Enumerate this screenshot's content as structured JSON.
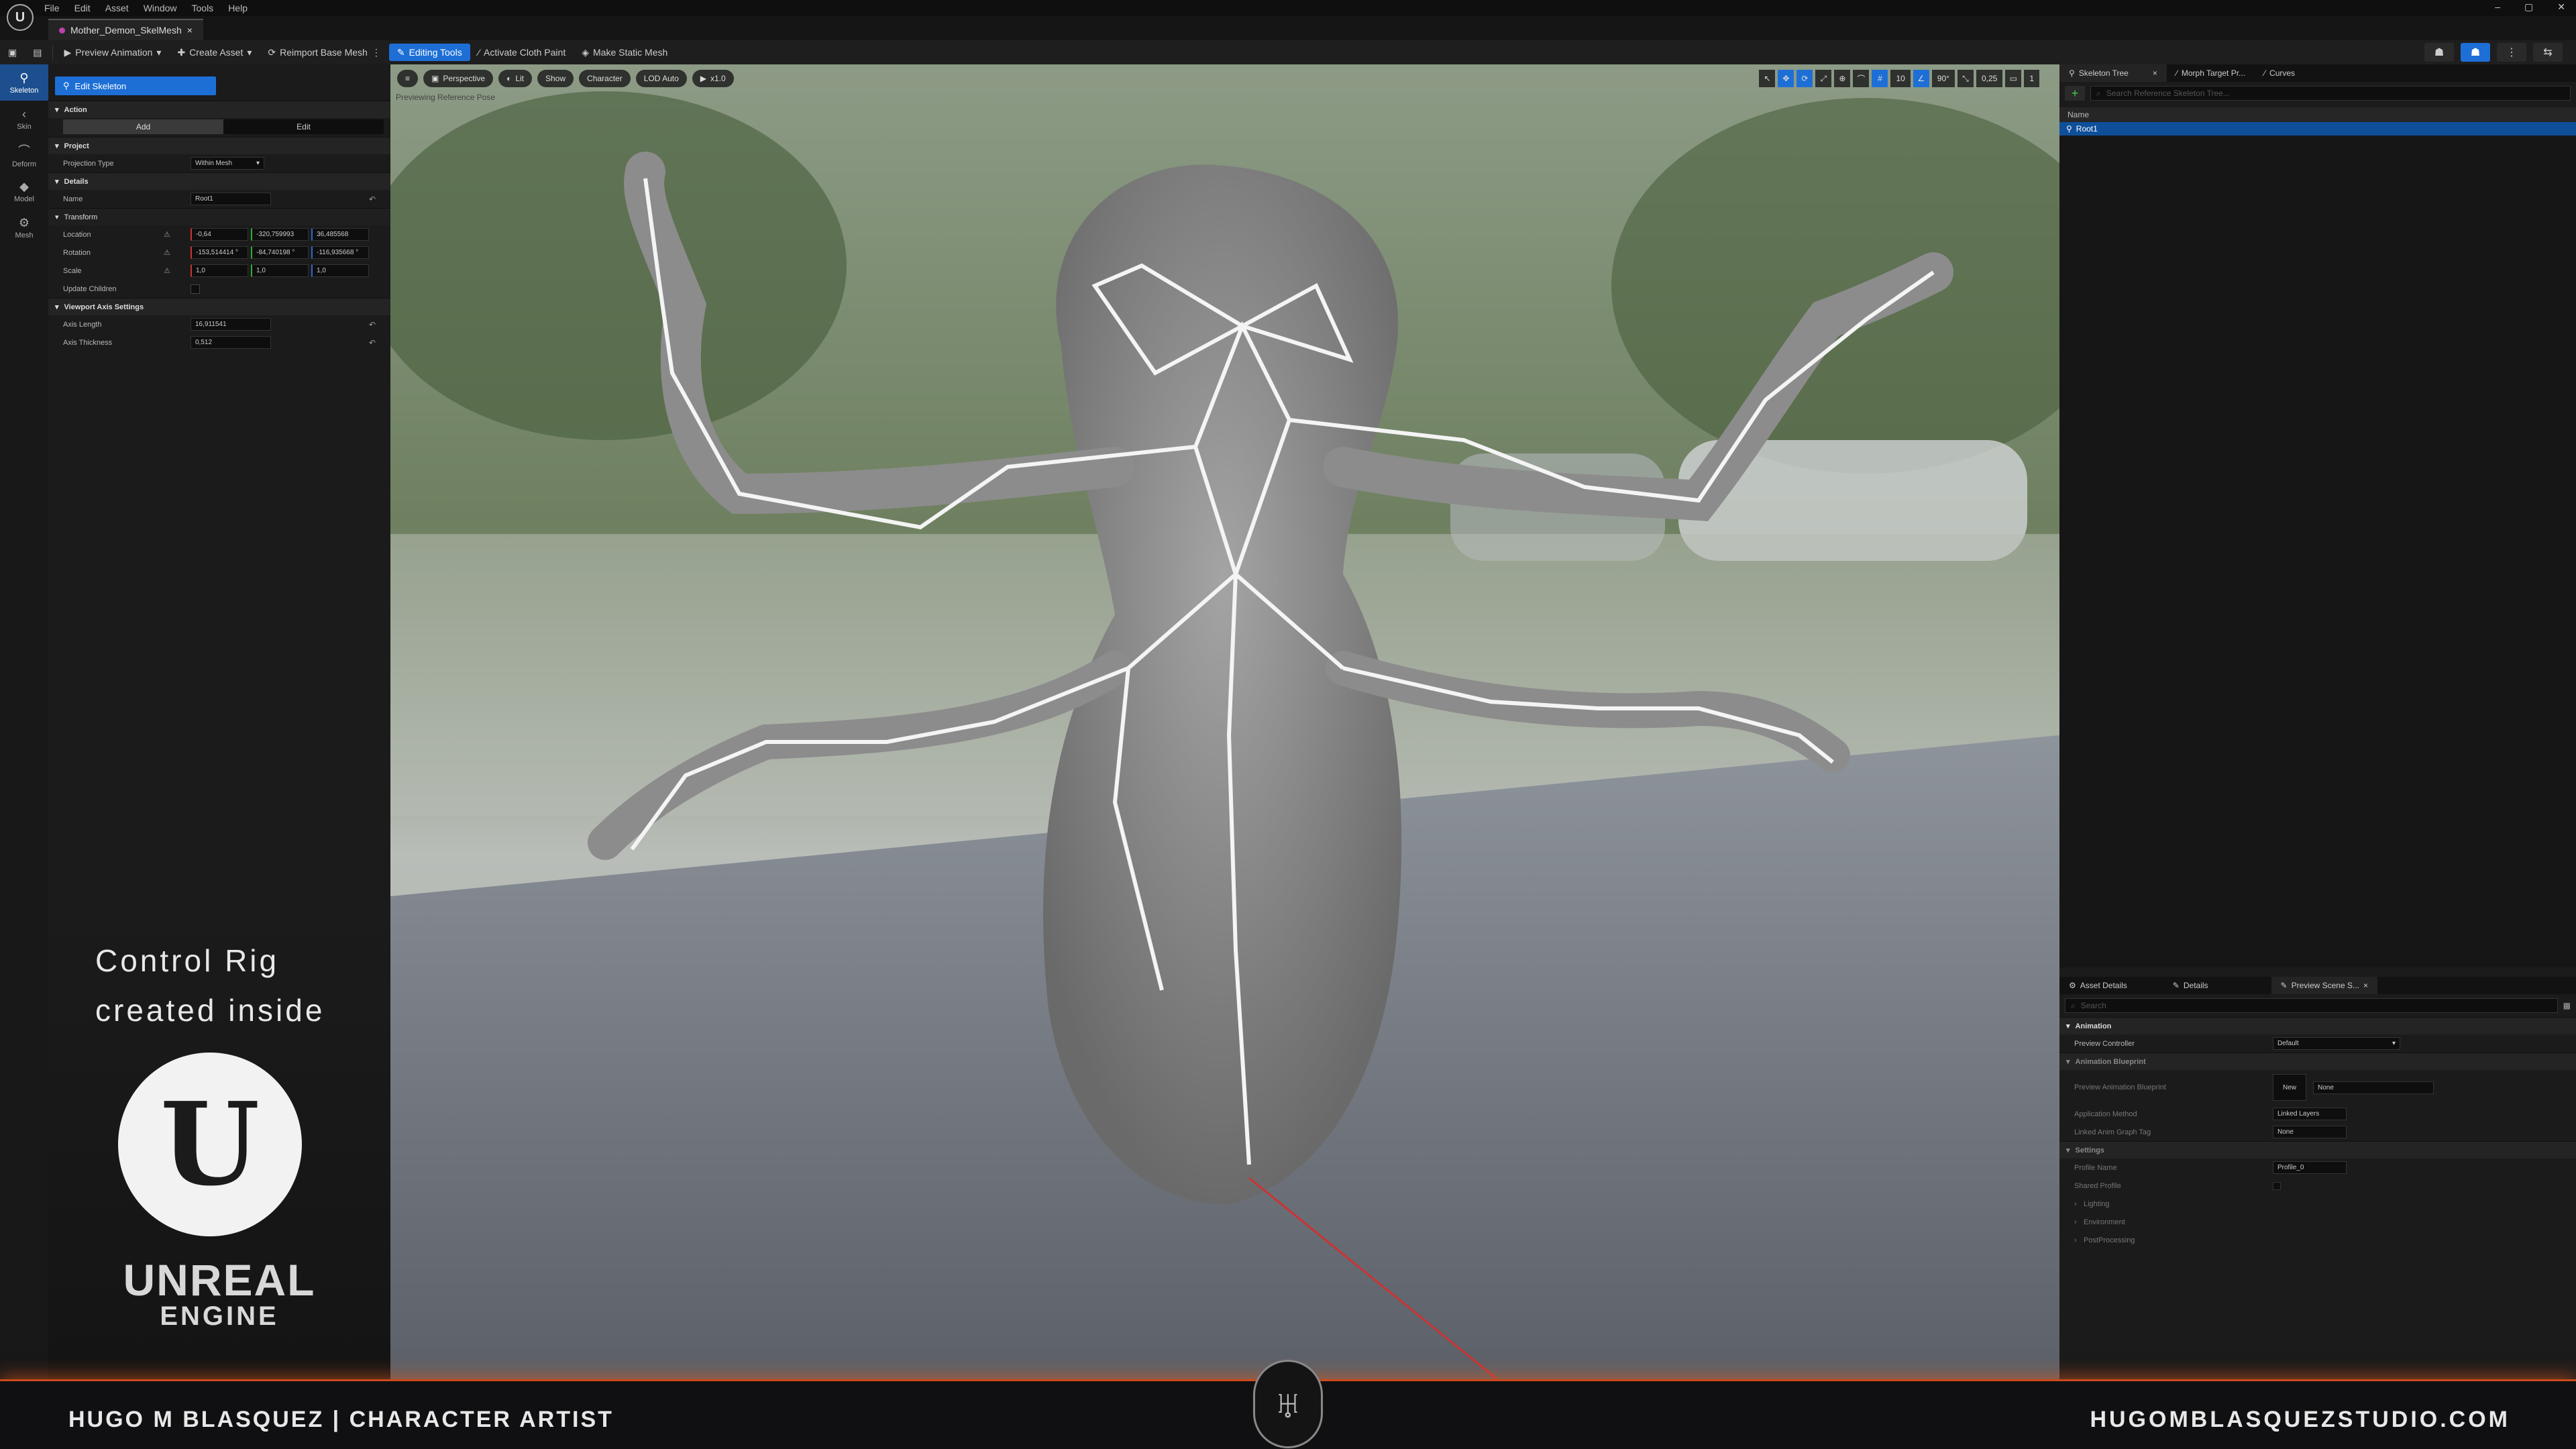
{
  "app": {
    "menu": [
      "File",
      "Edit",
      "Asset",
      "Window",
      "Tools",
      "Help"
    ],
    "document_tab": "Mother_Demon_SkelMesh"
  },
  "toolbar": {
    "preview_animation": "Preview Animation",
    "create_asset": "Create Asset",
    "reimport_base_mesh": "Reimport Base Mesh",
    "editing_tools": "Editing Tools",
    "activate_cloth_paint": "Activate Cloth Paint",
    "make_static_mesh": "Make Static Mesh"
  },
  "modes": [
    "Skeleton",
    "Skin",
    "Deform",
    "Model",
    "Mesh"
  ],
  "left_panel": {
    "mode_button": "Edit Skeleton",
    "action": {
      "title": "Action",
      "add": "Add",
      "edit": "Edit"
    },
    "project": {
      "title": "Project",
      "projection_type_label": "Projection Type",
      "projection_type_value": "Within Mesh"
    },
    "details": {
      "title": "Details",
      "name_label": "Name",
      "name_value": "Root1",
      "transform_title": "Transform",
      "location_label": "Location",
      "location": [
        "-0,64",
        "-320,759993",
        "36,485568"
      ],
      "rotation_label": "Rotation",
      "rotation": [
        "-153,514414 °",
        "-84,740198 °",
        "-116,935668 °"
      ],
      "scale_label": "Scale",
      "scale": [
        "1,0",
        "1,0",
        "1,0"
      ],
      "update_children_label": "Update Children"
    },
    "viewport_axis": {
      "title": "Viewport Axis Settings",
      "axis_length_label": "Axis Length",
      "axis_length_value": "16,911541",
      "axis_thickness_label": "Axis Thickness",
      "axis_thickness_value": "0,512"
    }
  },
  "promo": {
    "line1": "Control Rig",
    "line2": "created inside",
    "logo_word1": "UNREAL",
    "logo_word2": "ENGINE"
  },
  "viewport": {
    "perspective": "Perspective",
    "lit": "Lit",
    "show": "Show",
    "character": "Character",
    "lod": "LOD Auto",
    "speed": "x1.0",
    "preview_label": "Previewing Reference Pose",
    "grid_value": "10",
    "angle_value": "90°",
    "scale_value": "0,25",
    "camera_speed": "1"
  },
  "right_panel": {
    "tabs": [
      "Skeleton Tree",
      "Morph Target Pr...",
      "Curves"
    ],
    "search_placeholder": "Search Reference Skeleton Tree...",
    "column_name": "Name",
    "tree_root": "Root1",
    "bottom_tabs": [
      "Asset Details",
      "Details",
      "Preview Scene S..."
    ],
    "bottom_search_placeholder": "Search",
    "animation": {
      "title": "Animation",
      "preview_controller_label": "Preview Controller",
      "preview_controller_value": "Default"
    },
    "animation_blueprint": {
      "title": "Animation Blueprint",
      "preview_blueprint_label": "Preview Animation Blueprint",
      "new_label": "New",
      "preview_blueprint_value": "None",
      "application_method_label": "Application Method",
      "application_method_value": "Linked Layers",
      "linked_anim_graph_tag_label": "Linked Anim Graph Tag",
      "linked_anim_graph_tag_value": "None"
    },
    "settings": {
      "title": "Settings",
      "profile_name_label": "Profile Name",
      "profile_name_value": "Profile_0",
      "shared_profile_label": "Shared Profile"
    },
    "collapsed": [
      "Lighting",
      "Environment",
      "PostProcessing"
    ]
  },
  "footer": {
    "left": "HUGO M BLASQUEZ | CHARACTER ARTIST",
    "right": "HUGOMBLASQUEZSTUDIO.COM"
  }
}
